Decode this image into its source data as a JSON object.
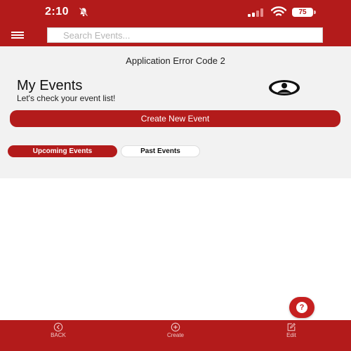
{
  "status_bar": {
    "time": "2:10",
    "battery": "75",
    "icons": [
      "bell-slash-icon",
      "signal-icon",
      "wifi-icon",
      "battery-icon"
    ]
  },
  "app_bar": {
    "menu_icon": "hamburger-menu-icon",
    "search_placeholder": "Search Events..."
  },
  "main": {
    "error_message": "Application Error Code 2",
    "title": "My Events",
    "subtitle": "Let's check your event list!",
    "profile_icon": "user-circle-icon",
    "create_button": "Create New Event",
    "tabs": [
      {
        "label": "Upcoming Events",
        "active": true
      },
      {
        "label": "Past Events",
        "active": false
      }
    ]
  },
  "help_fab": {
    "label": "?",
    "icon": "help-icon"
  },
  "bottom_nav": {
    "items": [
      {
        "label": "BACK",
        "icon": "back-circle-icon"
      },
      {
        "label": "Create",
        "icon": "plus-circle-icon"
      },
      {
        "label": "Edit",
        "icon": "edit-icon"
      }
    ]
  },
  "colors": {
    "brand_red": "#b31b1b",
    "content_bg": "#f2f2f2",
    "fab_red": "#c62020"
  }
}
